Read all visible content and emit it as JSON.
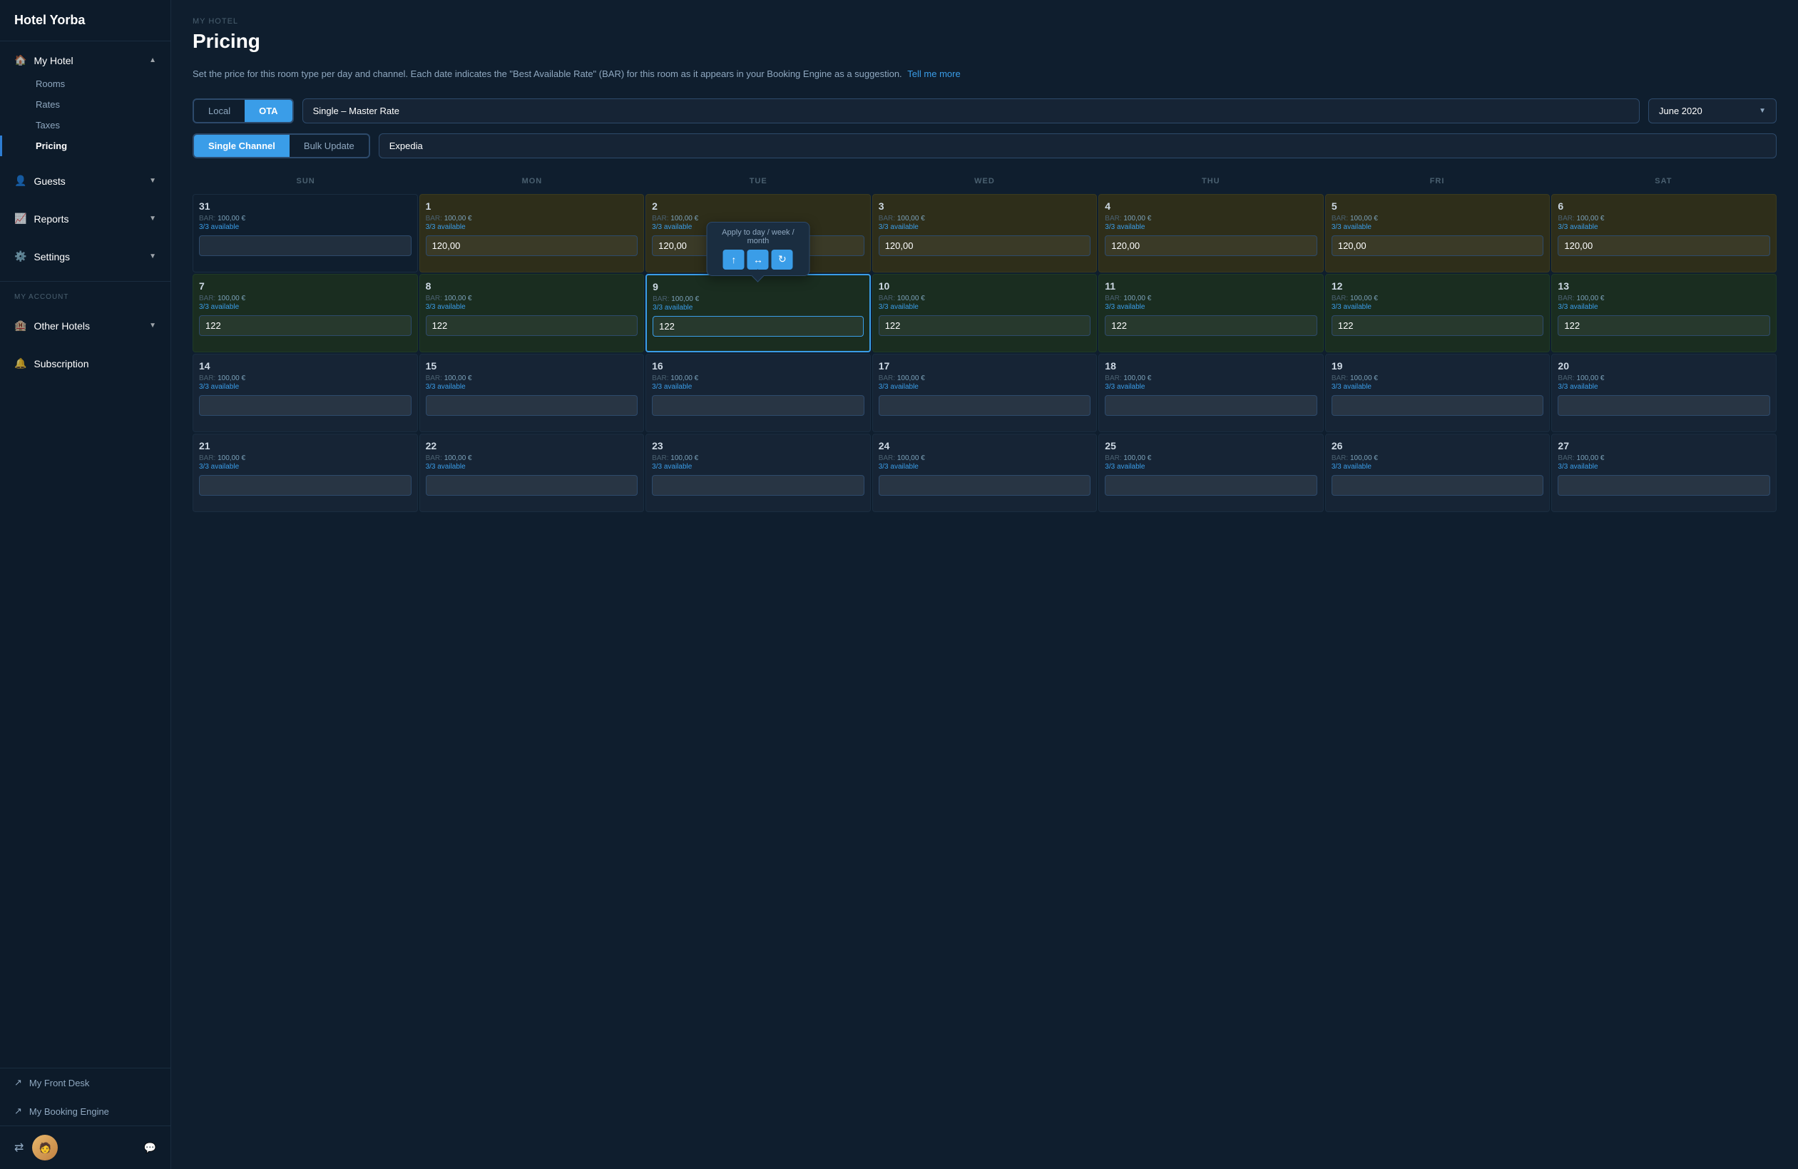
{
  "sidebar": {
    "hotel_name": "Hotel Yorba",
    "my_hotel_label": "My Hotel",
    "rooms_label": "Rooms",
    "rates_label": "Rates",
    "taxes_label": "Taxes",
    "pricing_label": "Pricing",
    "guests_label": "Guests",
    "reports_label": "Reports",
    "settings_label": "Settings",
    "my_account_label": "MY ACCOUNT",
    "other_hotels_label": "Other Hotels",
    "subscription_label": "Subscription",
    "front_desk_label": "My Front Desk",
    "booking_engine_label": "My Booking Engine"
  },
  "breadcrumb": "MY HOTEL",
  "page_title": "Pricing",
  "description": "Set the price for this room type per day and channel. Each date indicates the \"Best Available Rate\" (BAR) for this room as it appears in your Booking Engine as a suggestion.",
  "tell_me_more": "Tell me more",
  "controls": {
    "local_label": "Local",
    "ota_label": "OTA",
    "rate_plan": "Single – Master Rate",
    "month": "June 2020",
    "single_channel_label": "Single Channel",
    "bulk_update_label": "Bulk Update",
    "channel": "Expedia"
  },
  "calendar": {
    "days": [
      "SUN",
      "MON",
      "TUE",
      "WED",
      "THU",
      "FRI",
      "SAT"
    ],
    "tooltip": {
      "label": "Apply to day / week / month",
      "btn_day": "↑",
      "btn_week": "↔",
      "btn_month": "↻"
    },
    "weeks": [
      [
        {
          "day": "31",
          "bar": "100,00 €",
          "avail": "3/3 available",
          "value": "",
          "bg": "empty"
        },
        {
          "day": "1",
          "bar": "100,00 €",
          "avail": "3/3 available",
          "value": "120,00",
          "bg": "yellow"
        },
        {
          "day": "2",
          "bar": "100,00 €",
          "avail": "3/3 available",
          "value": "120,00",
          "bg": "yellow"
        },
        {
          "day": "3",
          "bar": "100,00 €",
          "avail": "3/3 available",
          "value": "120,00",
          "bg": "yellow"
        },
        {
          "day": "4",
          "bar": "100,00 €",
          "avail": "3/3 available",
          "value": "120,00",
          "bg": "yellow"
        },
        {
          "day": "5",
          "bar": "100,00 €",
          "avail": "3/3 available",
          "value": "120,00",
          "bg": "yellow"
        },
        {
          "day": "6",
          "bar": "100,00 €",
          "avail": "3/3 available",
          "value": "120,00",
          "bg": "yellow"
        }
      ],
      [
        {
          "day": "7",
          "bar": "100,00 €",
          "avail": "3/3 available",
          "value": "122",
          "bg": "green"
        },
        {
          "day": "8",
          "bar": "100,00 €",
          "avail": "3/3 available",
          "value": "122",
          "bg": "green"
        },
        {
          "day": "9",
          "bar": "100,00 €",
          "avail": "3/3 available",
          "value": "122",
          "bg": "green",
          "has_tooltip": true
        },
        {
          "day": "10",
          "bar": "100,00 €",
          "avail": "3/3 available",
          "value": "122",
          "bg": "green"
        },
        {
          "day": "11",
          "bar": "100,00 €",
          "avail": "3/3 available",
          "value": "122",
          "bg": "green"
        },
        {
          "day": "12",
          "bar": "100,00 €",
          "avail": "3/3 available",
          "value": "122",
          "bg": "green"
        },
        {
          "day": "13",
          "bar": "100,00 €",
          "avail": "3/3 available",
          "value": "122",
          "bg": "green"
        }
      ],
      [
        {
          "day": "14",
          "bar": "100,00 €",
          "avail": "3/3 available",
          "value": "",
          "bg": "normal"
        },
        {
          "day": "15",
          "bar": "100,00 €",
          "avail": "3/3 available",
          "value": "",
          "bg": "normal"
        },
        {
          "day": "16",
          "bar": "100,00 €",
          "avail": "3/3 available",
          "value": "",
          "bg": "normal"
        },
        {
          "day": "17",
          "bar": "100,00 €",
          "avail": "3/3 available",
          "value": "",
          "bg": "normal"
        },
        {
          "day": "18",
          "bar": "100,00 €",
          "avail": "3/3 available",
          "value": "",
          "bg": "normal"
        },
        {
          "day": "19",
          "bar": "100,00 €",
          "avail": "3/3 available",
          "value": "",
          "bg": "normal"
        },
        {
          "day": "20",
          "bar": "100,00 €",
          "avail": "3/3 available",
          "value": "",
          "bg": "normal"
        }
      ],
      [
        {
          "day": "21",
          "bar": "100,00 €",
          "avail": "3/3 available",
          "value": "",
          "bg": "normal"
        },
        {
          "day": "22",
          "bar": "100,00 €",
          "avail": "3/3 available",
          "value": "",
          "bg": "normal"
        },
        {
          "day": "23",
          "bar": "100,00 €",
          "avail": "3/3 available",
          "value": "",
          "bg": "normal"
        },
        {
          "day": "24",
          "bar": "100,00 €",
          "avail": "3/3 available",
          "value": "",
          "bg": "normal"
        },
        {
          "day": "25",
          "bar": "100,00 €",
          "avail": "3/3 available",
          "value": "",
          "bg": "normal"
        },
        {
          "day": "26",
          "bar": "100,00 €",
          "avail": "3/3 available",
          "value": "",
          "bg": "normal"
        },
        {
          "day": "27",
          "bar": "100,00 €",
          "avail": "3/3 available",
          "value": "",
          "bg": "normal"
        }
      ]
    ]
  }
}
